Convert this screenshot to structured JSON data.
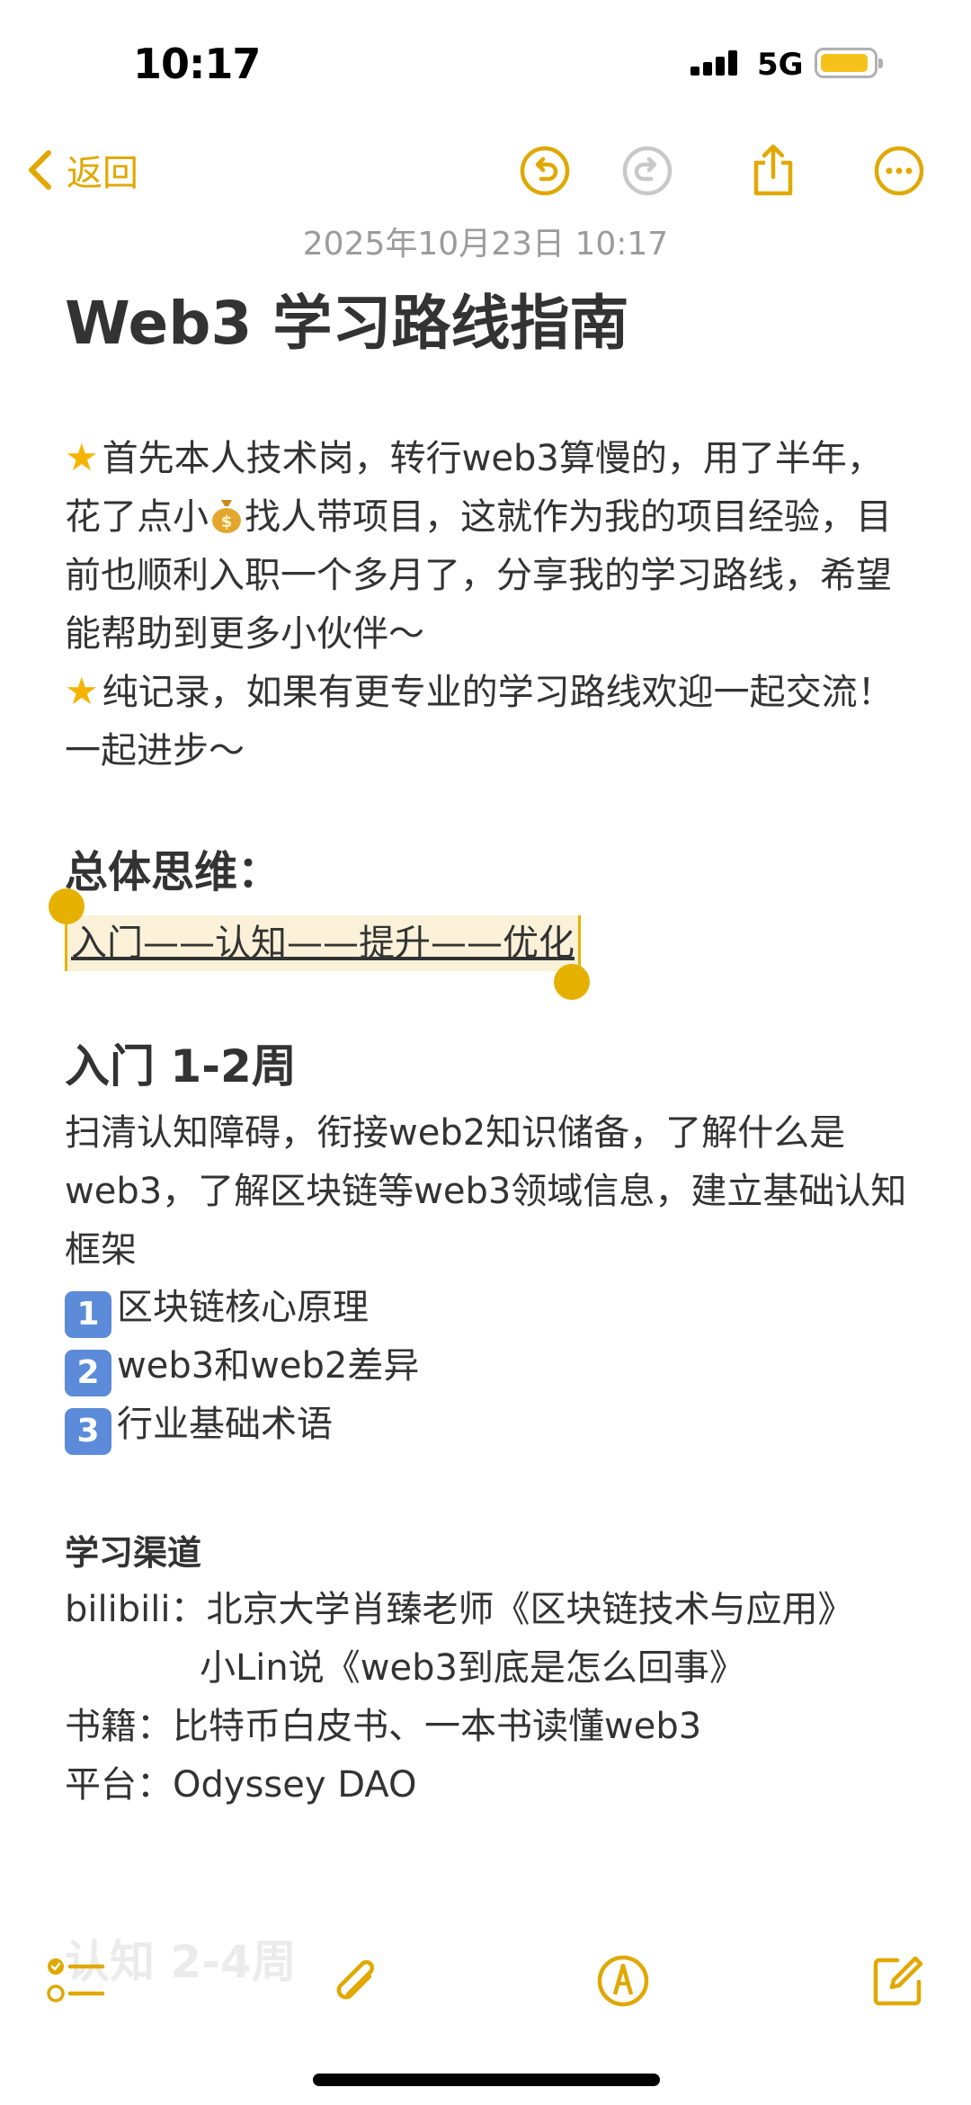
{
  "status_bar": {
    "time": "10:17",
    "network": "5G"
  },
  "nav": {
    "back_label": "返回"
  },
  "note": {
    "date": "2025年10月23日 10:17",
    "title": "Web3 学习路线指南",
    "intro_1": "首先本人技术岗，转行web3算慢的，用了半年，花了点小",
    "intro_1b": "找人带项目，这就作为我的项目经验，目前也顺利入职一个多月了，分享我的学习路线，希望能帮助到更多小伙伴～",
    "intro_2": "纯记录，如果有更专业的学习路线欢迎一起交流！一起进步～",
    "section_overall": "总体思维：",
    "overall_path": "入门——认知——提升——优化",
    "section_intro": "入门 1-2周",
    "intro_desc": "扫清认知障碍，衔接web2知识储备，了解什么是web3，了解区块链等web3领域信息，建立基础认知框架",
    "items": [
      {
        "num": "1",
        "text": "区块链核心原理"
      },
      {
        "num": "2",
        "text": "web3和web2差异"
      },
      {
        "num": "3",
        "text": "行业基础术语"
      }
    ],
    "channels_title": "学习渠道",
    "channels": [
      {
        "label": "bilibili：",
        "value": "北京大学肖臻老师《区块链技术与应用》"
      },
      {
        "label": "",
        "value": "小Lin说《web3到底是怎么回事》"
      },
      {
        "label": "书籍：",
        "value": "比特币白皮书、一本书读懂web3"
      },
      {
        "label": "平台：",
        "value": "Odyssey DAO"
      }
    ],
    "faded_heading": "认知 2-4周"
  },
  "colors": {
    "accent": "#e0a800",
    "selection": "#faf1d8",
    "numbox": "#5b8bd9"
  }
}
